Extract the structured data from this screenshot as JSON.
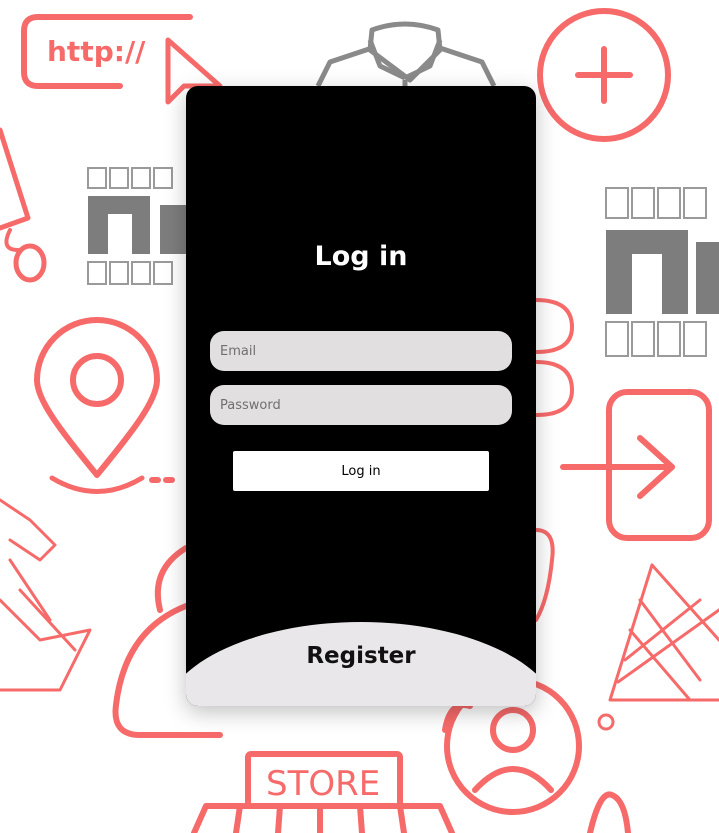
{
  "login": {
    "title": "Log in",
    "email_placeholder": "Email",
    "password_placeholder": "Password",
    "submit_label": "Log in",
    "register_label": "Register"
  },
  "background": {
    "url_text": "http://",
    "store_text": "STORE",
    "logo_icon": "fashion-clothing-logo",
    "accent_color": "#f76a6a",
    "grey_color": "#8a8a8a"
  }
}
